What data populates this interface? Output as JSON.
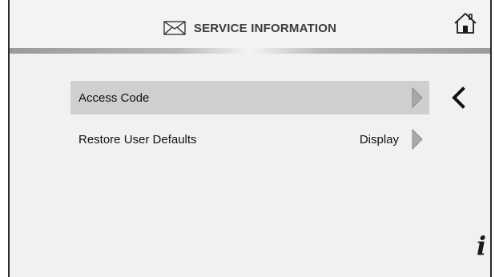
{
  "header": {
    "title": "SERVICE INFORMATION",
    "title_icon": "envelope-icon",
    "home_icon": "home-icon"
  },
  "rows": [
    {
      "label": "Access Code",
      "value": "",
      "selected": true,
      "arrow_icon": "triangle-right-icon"
    },
    {
      "label": "Restore User Defaults",
      "value": "Display",
      "selected": false,
      "arrow_icon": "triangle-right-icon"
    }
  ],
  "side": {
    "back_icon": "chevron-left-icon",
    "info_glyph": "i"
  },
  "colors": {
    "background": "#f1f1f1",
    "selected_row": "#cfcfcf",
    "arrow_fill": "#a9a9a9",
    "text": "#111111"
  }
}
